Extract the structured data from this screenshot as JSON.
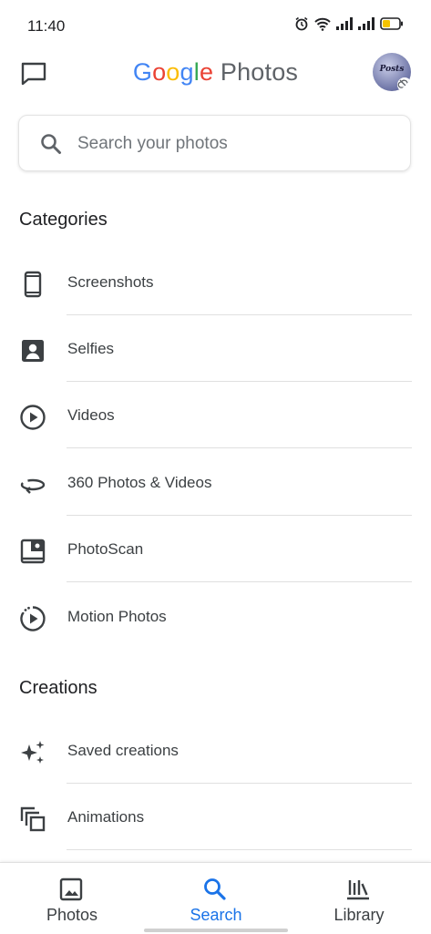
{
  "status_bar": {
    "time": "11:40",
    "icons": [
      "alarm-icon",
      "wifi-icon",
      "signal-icon",
      "signal-icon",
      "battery-icon"
    ],
    "battery_color": "#f5c400"
  },
  "header": {
    "title_google": [
      "G",
      "o",
      "o",
      "g",
      "l",
      "e"
    ],
    "title_photos": "Photos",
    "avatar_text": "Posts"
  },
  "search": {
    "placeholder": "Search your photos"
  },
  "categories": {
    "title": "Categories",
    "items": [
      {
        "label": "Screenshots",
        "icon": "phone-icon"
      },
      {
        "label": "Selfies",
        "icon": "selfie-icon"
      },
      {
        "label": "Videos",
        "icon": "play-circle-icon"
      },
      {
        "label": "360 Photos & Videos",
        "icon": "360-icon"
      },
      {
        "label": "PhotoScan",
        "icon": "photoscan-icon"
      },
      {
        "label": "Motion Photos",
        "icon": "motion-photo-icon"
      }
    ]
  },
  "creations": {
    "title": "Creations",
    "items": [
      {
        "label": "Saved creations",
        "icon": "sparkle-icon"
      },
      {
        "label": "Animations",
        "icon": "animation-icon"
      }
    ]
  },
  "bottom_nav": {
    "items": [
      {
        "label": "Photos",
        "icon": "photo-icon"
      },
      {
        "label": "Search",
        "icon": "search-icon"
      },
      {
        "label": "Library",
        "icon": "library-icon"
      }
    ],
    "active": "Search",
    "accent": "#1a73e8"
  },
  "colors": {
    "google_blue": "#4285F4",
    "google_red": "#EA4335",
    "google_yellow": "#FBBC05",
    "google_green": "#34A853"
  }
}
